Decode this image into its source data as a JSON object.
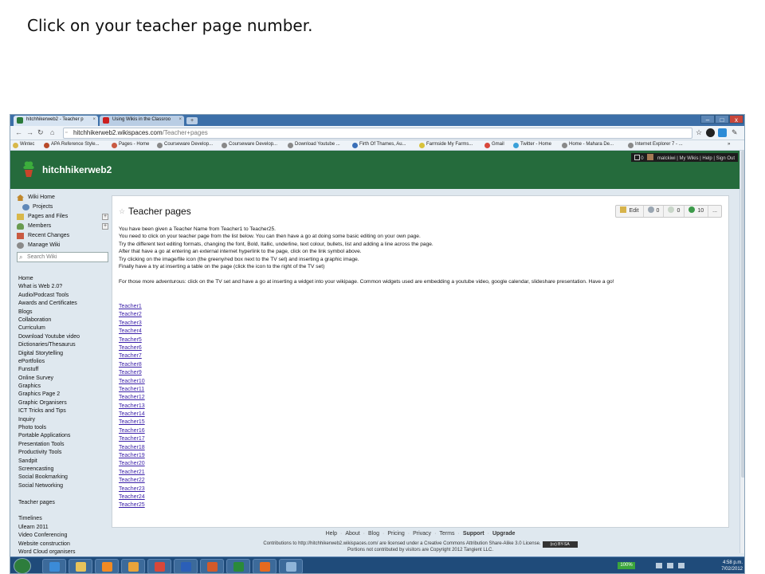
{
  "slide": {
    "instruction": "Click on your teacher page number."
  },
  "browser": {
    "tabs": [
      {
        "title": "hitchhikerweb2 - Teacher p",
        "favicon_color": "#2a7a3a"
      },
      {
        "title": "Using Wikis in the Classroo",
        "favicon_color": "#cc1f1f"
      }
    ],
    "new_tab_label": "+",
    "close_label": "×",
    "window_controls": [
      "–",
      "□",
      "x"
    ],
    "url_host": "hitchhikerweb2.wikispaces.com",
    "url_path": "/Teacher+pages",
    "bookmarks": [
      "Wintec",
      "APA Reference Style...",
      "Pages - Home",
      "Courseware Develop...",
      "Courseware Develop...",
      "Download Youtube ...",
      "Firth Of Thames, Au...",
      "Farmside My Farms...",
      "Gmail",
      "Twitter - Home",
      "Home - Mahara De...",
      "Internet Explorer 7 - ..."
    ],
    "bookmarks_more": "»"
  },
  "site": {
    "name": "hitchhikerweb2",
    "user_bar": {
      "username": "malckiwi",
      "links": [
        "My Wikis",
        "Help",
        "Sign Out"
      ],
      "message_count": "0"
    }
  },
  "sidebar": {
    "items": [
      {
        "label": "Wiki Home",
        "icon": "home-icon",
        "color": "#c0872b",
        "sub": false,
        "plus": false
      },
      {
        "label": "Projects",
        "icon": "projects-icon",
        "color": "#5f88b8",
        "sub": true,
        "plus": false
      },
      {
        "label": "Pages and Files",
        "icon": "folder-icon",
        "color": "#d8b84a",
        "sub": false,
        "plus": true
      },
      {
        "label": "Members",
        "icon": "members-icon",
        "color": "#6a9b50",
        "sub": false,
        "plus": true
      },
      {
        "label": "Recent Changes",
        "icon": "calendar-icon",
        "color": "#c95a42",
        "sub": false,
        "plus": false
      },
      {
        "label": "Manage Wiki",
        "icon": "gear-icon",
        "color": "#8a8a8a",
        "sub": false,
        "plus": false
      }
    ],
    "search_placeholder": "Search Wiki",
    "nav": [
      "Home",
      "What is Web 2.0?",
      "Audio/Podcast Tools",
      "Awards and Certificates",
      "Blogs",
      "Collaboration",
      "Curriculum",
      "Download Youtube video",
      "Dictionaries/Thesaurus",
      "Digital Storytelling",
      "ePortfolios",
      "Funstuff",
      "Online Survey",
      "Graphics",
      "Graphics Page 2",
      "Graphic Organisers",
      "ICT Tricks and Tips",
      "Inquiry",
      "Photo tools",
      "Portable Applications",
      "Presentation Tools",
      "Productivity Tools",
      "Sandpit",
      "Screencasting",
      "Social Bookmarking",
      "Social Networking",
      "",
      "Teacher pages",
      "",
      "Timelines",
      "Ulearn 2011",
      "Video Conferencing",
      "Website construction",
      "Word Cloud organisers"
    ]
  },
  "content": {
    "title": "Teacher pages",
    "actions": [
      {
        "label": "Edit",
        "icon": "edit-icon"
      },
      {
        "label": "0",
        "icon": "comments-icon"
      },
      {
        "label": "0",
        "icon": "discussion-icon"
      },
      {
        "label": "10",
        "icon": "history-icon"
      },
      {
        "label": "...",
        "icon": ""
      }
    ],
    "paragraphs": [
      "You have been given a Teacher Name from Teacher1 to Teacher25.",
      "You need to click on your teacher page from the list below. You can then have a go at doing some basic editing on your own page.",
      "Try the different text editing formats, changing the font, Bold, Itallic, underline, text colour, bullets, list and adding a line across the page.",
      "After that have a go at entering an external internet hyperlink to the page, click on the link symbol above.",
      "Try clicking on the image/file icon (the greeny/red box next to the TV set) and inserting a graphic image.",
      "Finally have a try at inserting a table on the page (click the icon to the right of the TV set)",
      "",
      "For those more adventurous: click on the TV set and have a go at inserting a widget into your wikipage. Common widgets used are embedding a youtube video, google calendar, slideshare presentation. Have a go!"
    ],
    "teacher_links": [
      "Teacher1",
      "Teacher2",
      "Teacher3",
      "Teacher4",
      "Teacher5",
      "Teacher6",
      "Teacher7",
      "Teacher8",
      "Teacher9",
      "Teacher10",
      "Teacher11",
      "Teacher12",
      "Teacher13",
      "Teacher14",
      "Teacher15",
      "Teacher16",
      "Teacher17",
      "Teacher18",
      "Teacher19",
      "Teacher20",
      "Teacher21",
      "Teacher22",
      "Teacher23",
      "Teacher24",
      "Teacher25"
    ]
  },
  "footer": {
    "links": [
      {
        "label": "Help",
        "bold": false
      },
      {
        "label": "About",
        "bold": false
      },
      {
        "label": "Blog",
        "bold": false
      },
      {
        "label": "Pricing",
        "bold": false
      },
      {
        "label": "Privacy",
        "bold": false
      },
      {
        "label": "Terms",
        "bold": false
      },
      {
        "label": "Support",
        "bold": true
      },
      {
        "label": "Upgrade",
        "bold": true
      }
    ],
    "separator": "·",
    "license": "Contributions to http://hitchhikerweb2.wikispaces.com/ are licensed under a Creative Commons Attribution Share-Alike 3.0 License.",
    "cc_badge": "(cc) BY-SA",
    "copyright": "Portions not contributed by visitors are Copyright 2012 Tangient LLC."
  },
  "taskbar": {
    "apps": [
      {
        "name": "ie-icon",
        "color": "#3b8bd8"
      },
      {
        "name": "explorer-icon",
        "color": "#e7c35a"
      },
      {
        "name": "media-icon",
        "color": "#f08a24"
      },
      {
        "name": "outlook-icon",
        "color": "#e8a33a"
      },
      {
        "name": "chrome-icon",
        "color": "#d8473a"
      },
      {
        "name": "word-icon",
        "color": "#2b5fb8"
      },
      {
        "name": "powerpoint-icon",
        "color": "#d35a2a"
      },
      {
        "name": "excel-icon",
        "color": "#2a8a3a"
      },
      {
        "name": "firefox-icon",
        "color": "#e56a1f"
      },
      {
        "name": "paint-icon",
        "color": "#8fb4d8"
      }
    ],
    "battery": "100%",
    "time": "4:58 p.m.",
    "date": "7/02/2012"
  }
}
